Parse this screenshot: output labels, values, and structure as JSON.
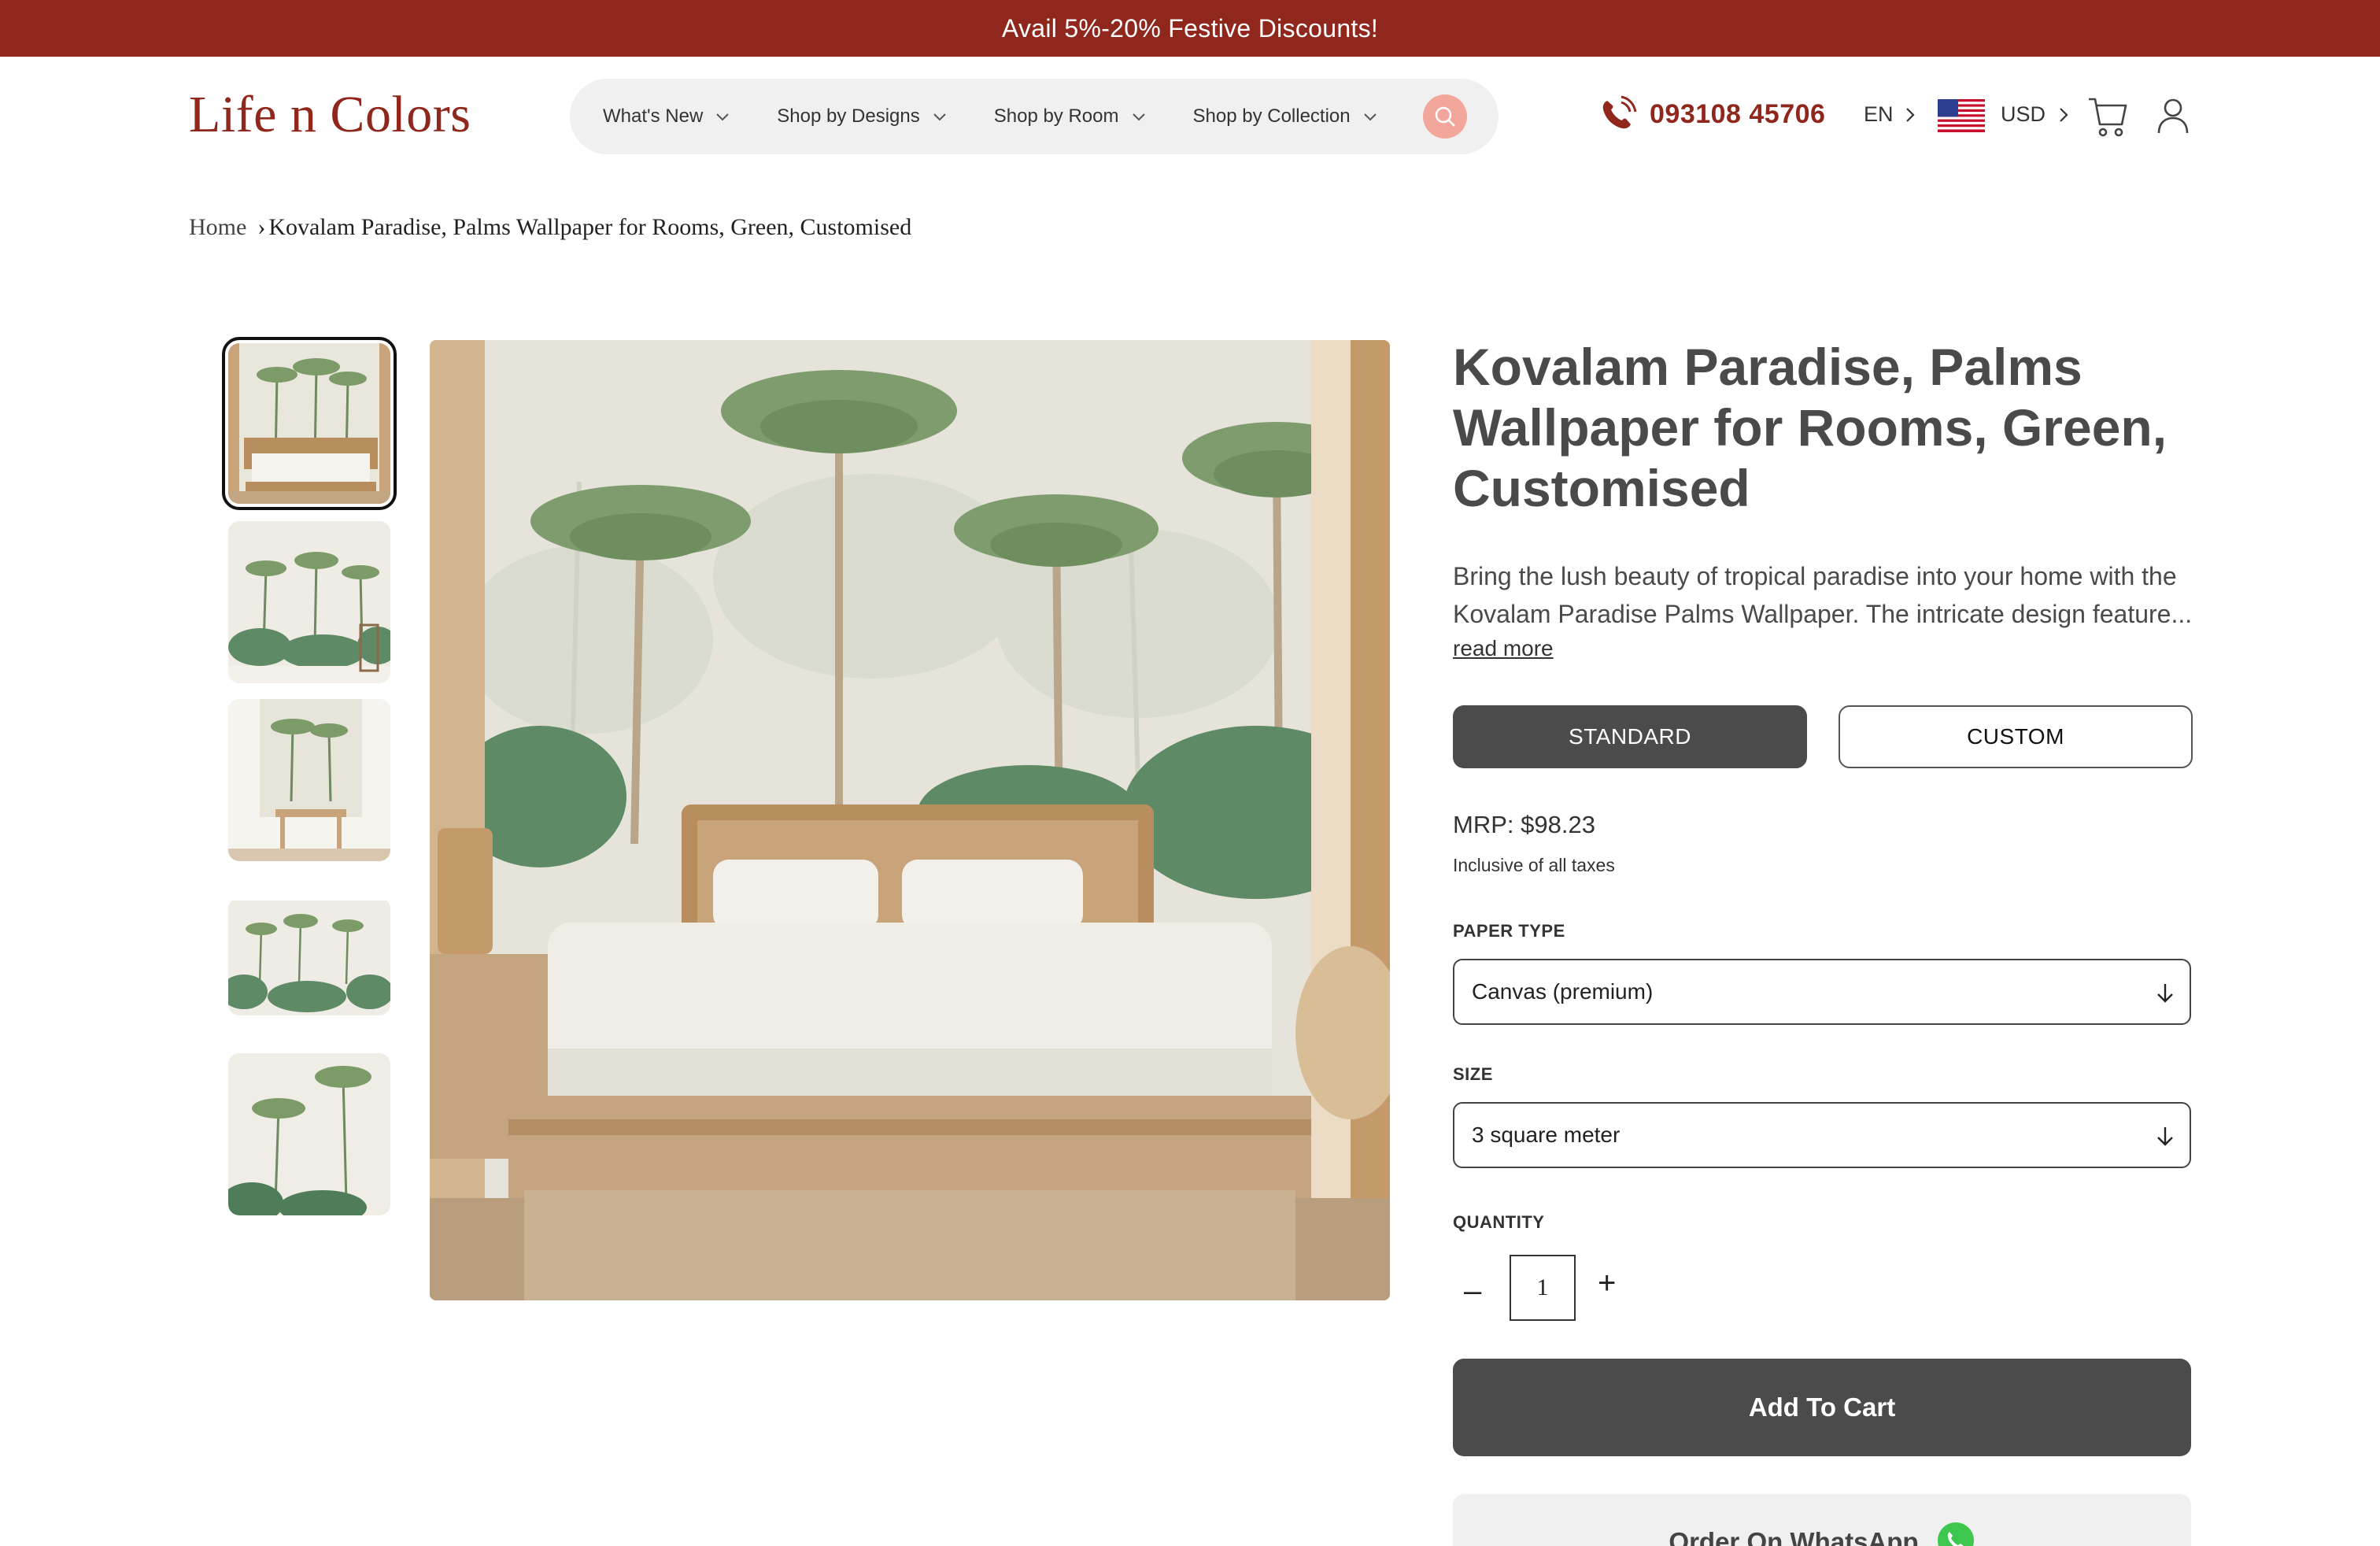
{
  "announcement": "Avail 5%-20% Festive Discounts!",
  "brand": {
    "logo": "Life n Colors",
    "accent_color": "#8f271d"
  },
  "nav": {
    "items": [
      {
        "label": "What's New"
      },
      {
        "label": "Shop by Designs"
      },
      {
        "label": "Shop by Room"
      },
      {
        "label": "Shop by Collection"
      }
    ]
  },
  "header": {
    "phone": "093108 45706",
    "language": "EN",
    "currency": "USD",
    "icons": [
      "phone-icon",
      "search-icon",
      "us-flag-icon",
      "cart-icon",
      "user-icon"
    ]
  },
  "breadcrumb": {
    "home": "Home",
    "separator": "›",
    "current": "Kovalam Paradise, Palms Wallpaper for Rooms, Green, Customised"
  },
  "product": {
    "title": "Kovalam Paradise, Palms Wallpaper for Rooms, Green, Customised",
    "description": "Bring the lush beauty of tropical paradise into your home with the Kovalam Paradise Palms Wallpaper. The intricate design feature...",
    "read_more": "read more",
    "options": {
      "standard": "STANDARD",
      "custom": "CUSTOM",
      "selected": "STANDARD"
    },
    "mrp": "MRP: $98.23",
    "tax_note": "Inclusive of all taxes",
    "paper_type": {
      "label": "PAPER TYPE",
      "value": "Canvas (premium)"
    },
    "size": {
      "label": "SIZE",
      "value": "3 square meter"
    },
    "quantity": {
      "label": "QUANTITY",
      "value": "1",
      "minus": "–",
      "plus": "+"
    },
    "add_to_cart": "Add To Cart",
    "whatsapp": "Order On WhatsApp"
  },
  "gallery": {
    "thumbnail_count": 5,
    "active_index": 0
  }
}
